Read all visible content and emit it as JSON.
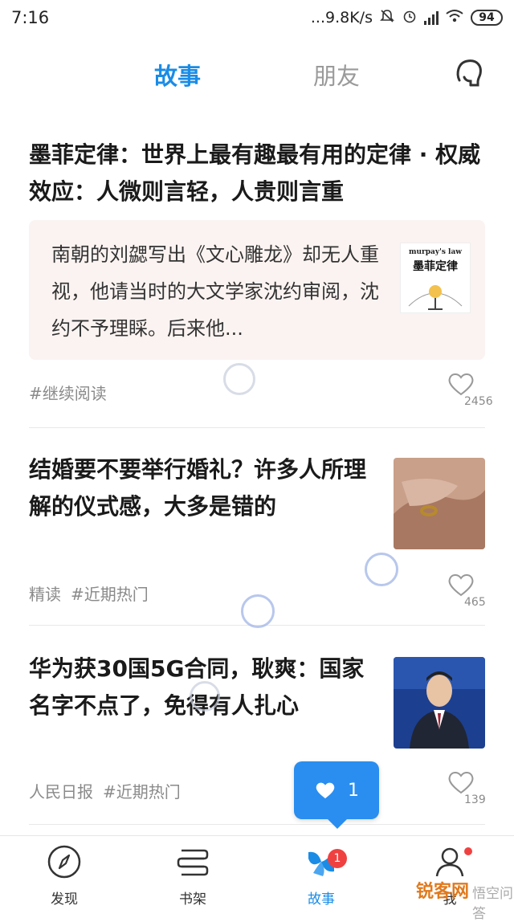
{
  "status_bar": {
    "time": "7:16",
    "net_speed": "...9.8K/s",
    "battery": "94",
    "icons": [
      "mute-bell-icon",
      "alarm-icon",
      "signal-icon",
      "wifi-icon",
      "battery-icon"
    ]
  },
  "top_tabs": {
    "active": "故事",
    "inactive": "朋友",
    "profile_icon": "chat-head-icon"
  },
  "feed": [
    {
      "title": "墨菲定律：世界上最有趣最有用的定律 · 权威效应：人微则言轻，人贵则言重",
      "excerpt": "南朝的刘勰写出《文心雕龙》却无人重视，他请当时的大文学家沈约审阅，沈约不予理睬。后来他...",
      "thumb_en": "murpay's law",
      "thumb_zh": "墨菲定律",
      "tags": [
        "#继续阅读"
      ],
      "likes": "2456"
    },
    {
      "title": "结婚要不要举行婚礼？许多人所理解的仪式感，大多是错的",
      "tags": [
        "精读",
        "#近期热门"
      ],
      "likes": "465"
    },
    {
      "title": "华为获30国5G合同，耿爽：国家名字不点了，免得有人扎心",
      "tags": [
        "人民日报",
        "#近期热门"
      ],
      "likes": "139"
    }
  ],
  "like_toast": {
    "count": "1"
  },
  "bottom_nav": {
    "items": [
      {
        "label": "发现",
        "icon": "compass-icon"
      },
      {
        "label": "书架",
        "icon": "bookshelf-icon"
      },
      {
        "label": "故事",
        "icon": "story-icon",
        "badge": "1"
      },
      {
        "label": "我",
        "icon": "profile-icon"
      }
    ]
  },
  "watermark": {
    "brand": "锐客网",
    "suffix": "悟空问答"
  },
  "colors": {
    "accent": "#1a8ce6",
    "badge": "#f04141",
    "quote_bg": "#faf3f1"
  }
}
